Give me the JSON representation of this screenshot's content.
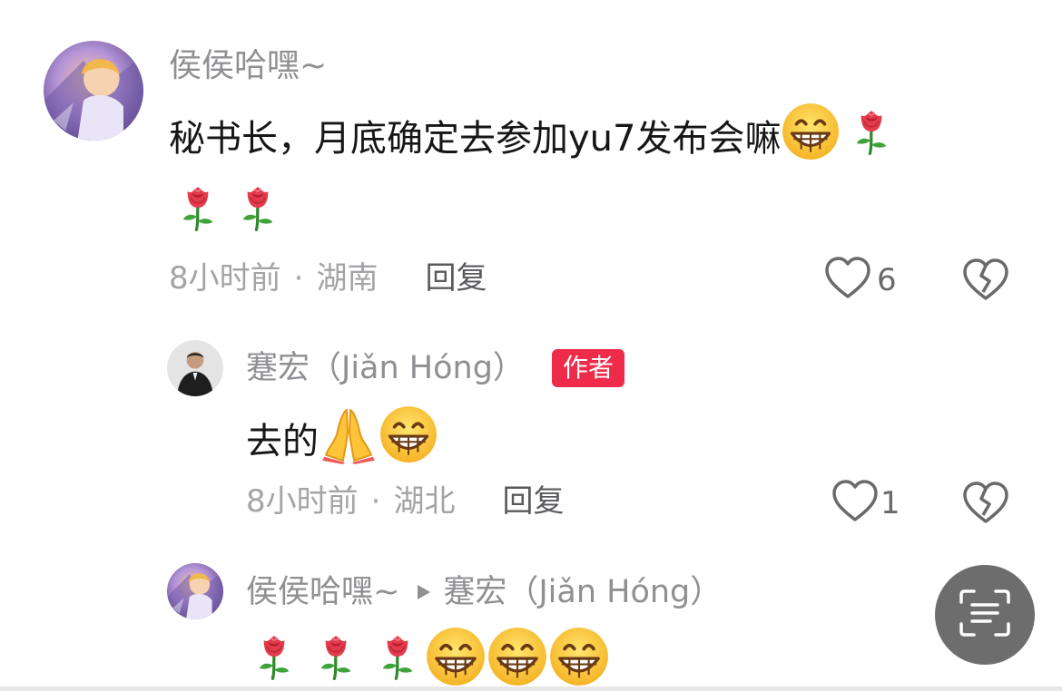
{
  "comment1": {
    "username": "侯侯哈嘿~",
    "text": "秘书长，月底确定去参加yu7发布会嘛",
    "time": "8小时前",
    "location": "湖南",
    "reply_label": "回复",
    "like_count": "6",
    "icons": [
      "grin-emoji",
      "rose-emoji",
      "rose-emoji",
      "rose-emoji"
    ]
  },
  "reply1": {
    "username": "蹇宏（Jiǎn Hóng）",
    "author_badge": "作者",
    "text": "去的",
    "time": "8小时前",
    "location": "湖北",
    "reply_label": "回复",
    "like_count": "1",
    "icons": [
      "pray-emoji",
      "grin-emoji"
    ]
  },
  "reply2": {
    "username": "侯侯哈嘿~",
    "reply_to": "蹇宏（Jiǎn Hóng）",
    "icons": [
      "rose-emoji",
      "rose-emoji",
      "rose-emoji",
      "grin-emoji",
      "grin-emoji",
      "grin-emoji"
    ]
  },
  "separator": "·",
  "colors": {
    "username": "#8f8f94",
    "text": "#161616",
    "meta": "#a4a4a8",
    "badge": "#ee2c4a",
    "scan_button": "#6d6d6d"
  }
}
